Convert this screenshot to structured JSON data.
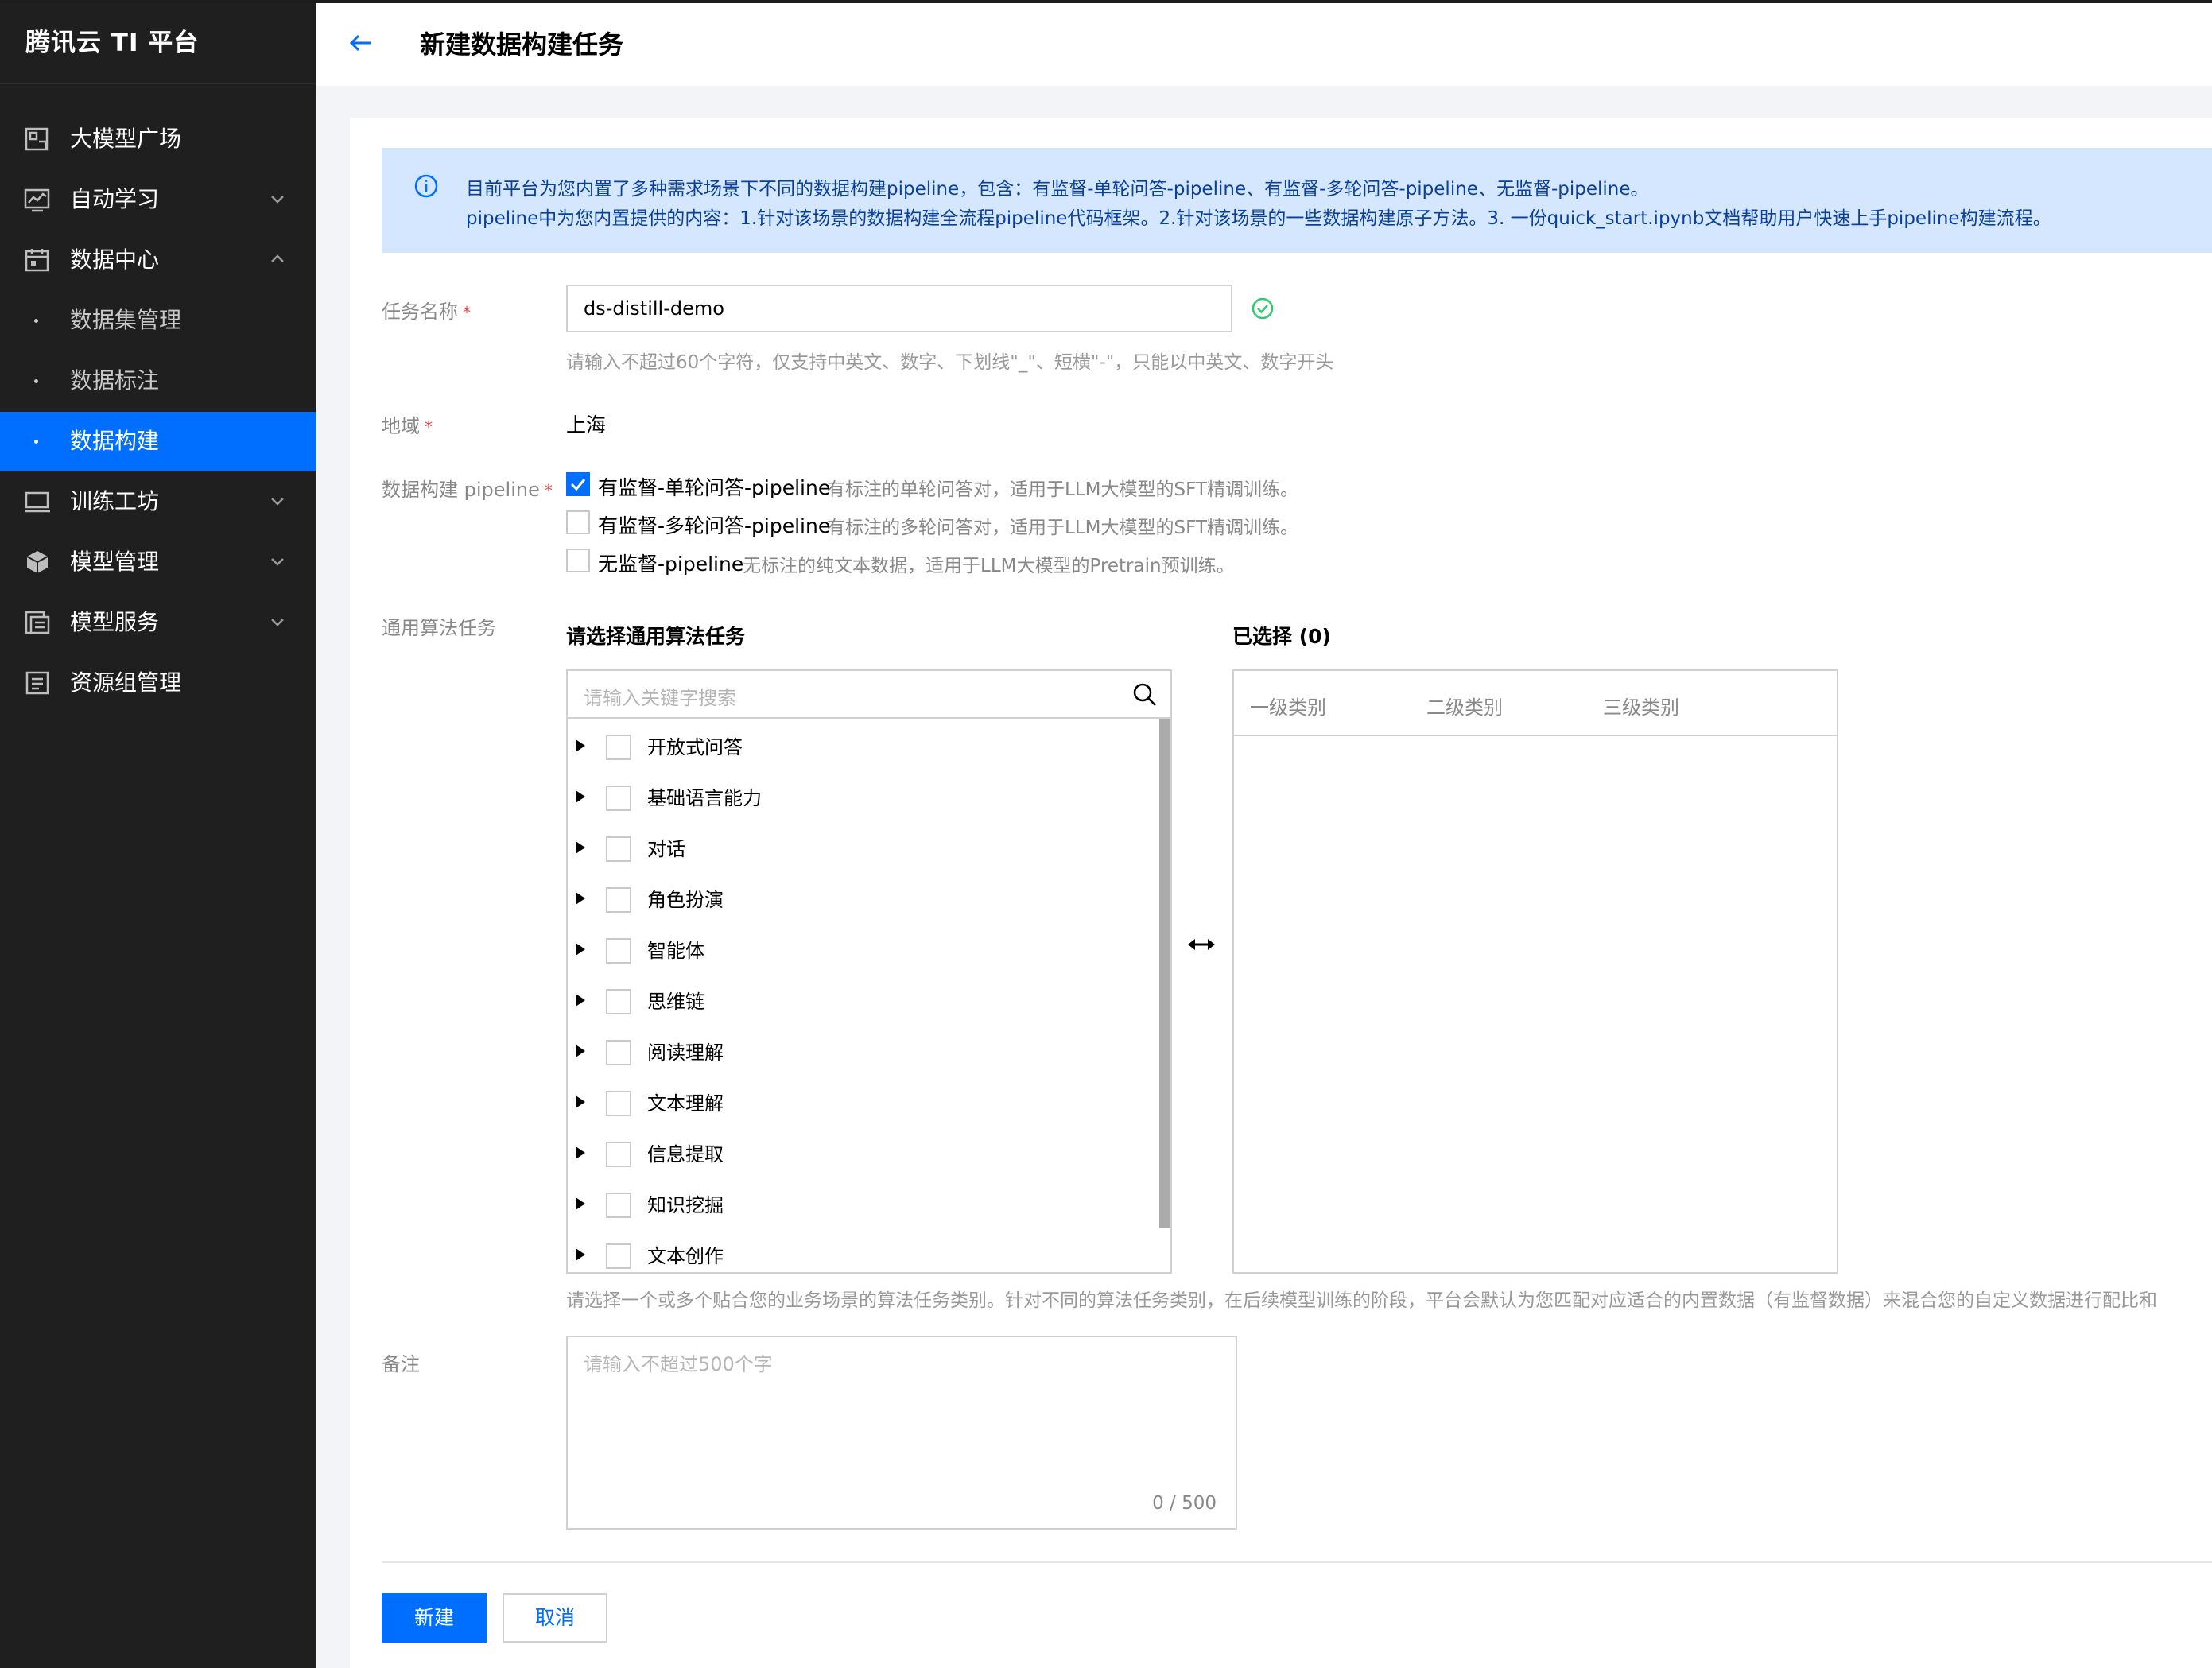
{
  "brand": "腾讯云 TI 平台",
  "nav": {
    "items": [
      {
        "label": "大模型广场",
        "icon": "model-square-icon",
        "expandable": false
      },
      {
        "label": "自动学习",
        "icon": "auto-learning-icon",
        "expandable": true
      },
      {
        "label": "数据中心",
        "icon": "data-center-icon",
        "expandable": true,
        "expanded": true
      },
      {
        "label": "数据集管理",
        "sub": true
      },
      {
        "label": "数据标注",
        "sub": true
      },
      {
        "label": "数据构建",
        "sub": true,
        "active": true
      },
      {
        "label": "训练工坊",
        "icon": "training-workshop-icon",
        "expandable": true
      },
      {
        "label": "模型管理",
        "icon": "model-management-icon",
        "expandable": true
      },
      {
        "label": "模型服务",
        "icon": "model-service-icon",
        "expandable": true
      },
      {
        "label": "资源组管理",
        "icon": "resource-group-icon",
        "expandable": false
      }
    ]
  },
  "header": {
    "title": "新建数据构建任务"
  },
  "notice": {
    "line1": "目前平台为您内置了多种需求场景下不同的数据构建pipeline，包含：有监督-单轮问答-pipeline、有监督-多轮问答-pipeline、无监督-pipeline。",
    "line2": "pipeline中为您内置提供的内容：1.针对该场景的数据构建全流程pipeline代码框架。2.针对该场景的一些数据构建原子方法。3. 一份quick_start.ipynb文档帮助用户快速上手pipeline构建流程。"
  },
  "form": {
    "task_name": {
      "label": "任务名称",
      "value": "ds-distill-demo",
      "hint": "请输入不超过60个字符，仅支持中英文、数字、下划线\"_\"、短横\"-\"，只能以中英文、数字开头"
    },
    "region": {
      "label": "地域",
      "value": "上海"
    },
    "pipeline": {
      "label": "数据构建 pipeline",
      "options": [
        {
          "name": "有监督-单轮问答-pipeline",
          "desc": "有标注的单轮问答对，适用于LLM大模型的SFT精调训练。",
          "checked": true
        },
        {
          "name": "有监督-多轮问答-pipeline",
          "desc": "有标注的多轮问答对，适用于LLM大模型的SFT精调训练。",
          "checked": false
        },
        {
          "name": "无监督-pipeline",
          "desc": "无标注的纯文本数据，适用于LLM大模型的Pretrain预训练。",
          "checked": false
        }
      ]
    },
    "algo": {
      "label": "通用算法任务",
      "left_title": "请选择通用算法任务",
      "right_title": "已选择 (0)",
      "search_placeholder": "请输入关键字搜索",
      "tasks": [
        "开放式问答",
        "基础语言能力",
        "对话",
        "角色扮演",
        "智能体",
        "思维链",
        "阅读理解",
        "文本理解",
        "信息提取",
        "知识挖掘",
        "文本创作"
      ],
      "columns": [
        "一级类别",
        "二级类别",
        "三级类别"
      ],
      "hint": "请选择一个或多个贴合您的业务场景的算法任务类别。针对不同的算法任务类别，在后续模型训练的阶段，平台会默认为您匹配对应适合的内置数据（有监督数据）来混合您的自定义数据进行配比和"
    },
    "remark": {
      "label": "备注",
      "placeholder": "请输入不超过500个字",
      "counter": "0 / 500"
    }
  },
  "actions": {
    "create": "新建",
    "cancel": "取消"
  },
  "colors": {
    "primary": "#006eff",
    "sidebar_bg": "#1f1f1f",
    "notice_bg": "#d5e7ff",
    "success": "#29cc6a",
    "required": "#e54545"
  }
}
